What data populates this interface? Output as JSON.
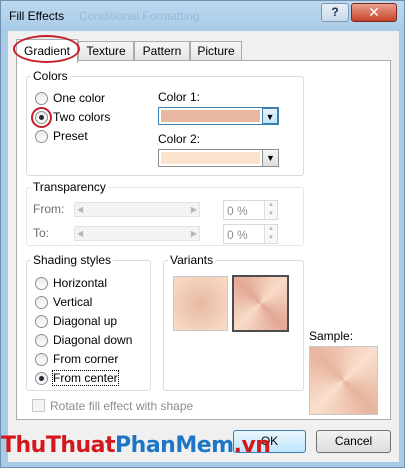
{
  "window": {
    "title": "Fill Effects",
    "title_ghost": "Conditional Formatting",
    "help_label": "?",
    "close_label": "✕"
  },
  "tabs": [
    {
      "label": "Gradient",
      "active": true
    },
    {
      "label": "Texture",
      "active": false
    },
    {
      "label": "Pattern",
      "active": false
    },
    {
      "label": "Picture",
      "active": false
    }
  ],
  "colors": {
    "group_title": "Colors",
    "options": [
      {
        "label": "One color",
        "checked": false
      },
      {
        "label": "Two colors",
        "checked": true
      },
      {
        "label": "Preset",
        "checked": false
      }
    ],
    "color1_label": "Color 1:",
    "color1_value": "#e8b7a1",
    "color2_label": "Color 2:",
    "color2_value": "#fbe3ce"
  },
  "transparency": {
    "group_title": "Transparency",
    "from_label": "From:",
    "from_value": "0 %",
    "to_label": "To:",
    "to_value": "0 %"
  },
  "shading": {
    "group_title": "Shading styles",
    "options": [
      {
        "label": "Horizontal",
        "checked": false
      },
      {
        "label": "Vertical",
        "checked": false
      },
      {
        "label": "Diagonal up",
        "checked": false
      },
      {
        "label": "Diagonal down",
        "checked": false
      },
      {
        "label": "From corner",
        "checked": false
      },
      {
        "label": "From center",
        "checked": true
      }
    ]
  },
  "variants": {
    "group_title": "Variants"
  },
  "sample_label": "Sample:",
  "rotate_label": "Rotate fill effect with shape",
  "buttons": {
    "ok": "OK",
    "cancel": "Cancel"
  },
  "watermark": {
    "part1": "Thu",
    "part2": "Thuat",
    "part3": "Phan",
    "part4": "Mem",
    "part5": ".vn"
  },
  "colors_accent": {
    "highlight_ring": "#c4202a",
    "dialog_bg": "#f0f0f0",
    "title_bar": "#a9cbe8"
  }
}
